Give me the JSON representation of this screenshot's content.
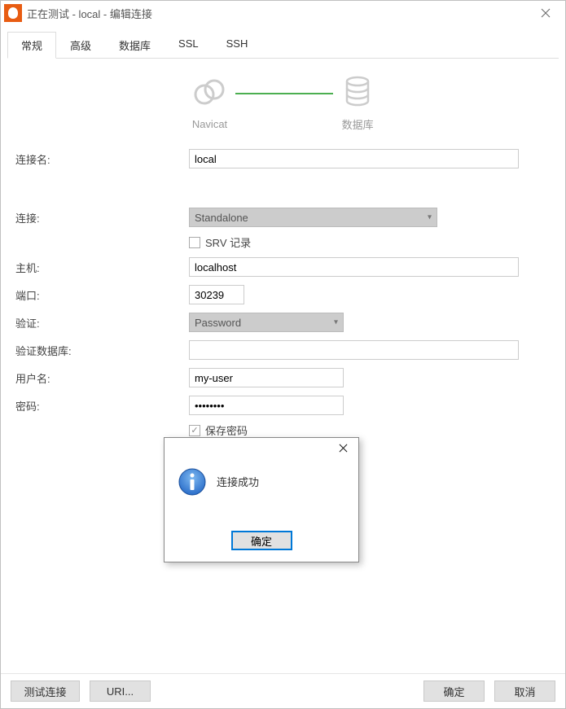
{
  "window": {
    "title": "正在测试 - local - 编辑连接"
  },
  "tabs": [
    {
      "label": "常规",
      "active": true
    },
    {
      "label": "高级",
      "active": false
    },
    {
      "label": "数据库",
      "active": false
    },
    {
      "label": "SSL",
      "active": false
    },
    {
      "label": "SSH",
      "active": false
    }
  ],
  "diagram": {
    "from_label": "Navicat",
    "to_label": "数据库"
  },
  "form": {
    "connection_name_label": "连接名:",
    "connection_name_value": "local",
    "connection_label": "连接:",
    "connection_value": "Standalone",
    "srv_label": "SRV 记录",
    "host_label": "主机:",
    "host_value": "localhost",
    "port_label": "端口:",
    "port_value": "30239",
    "auth_label": "验证:",
    "auth_value": "Password",
    "authdb_label": "验证数据库:",
    "authdb_value": "",
    "username_label": "用户名:",
    "username_value": "my-user",
    "password_label": "密码:",
    "password_value": "••••••••",
    "save_password_label": "保存密码"
  },
  "footer": {
    "test_label": "测试连接",
    "uri_label": "URI...",
    "ok_label": "确定",
    "cancel_label": "取消"
  },
  "modal": {
    "message": "连接成功",
    "ok_label": "确定"
  }
}
